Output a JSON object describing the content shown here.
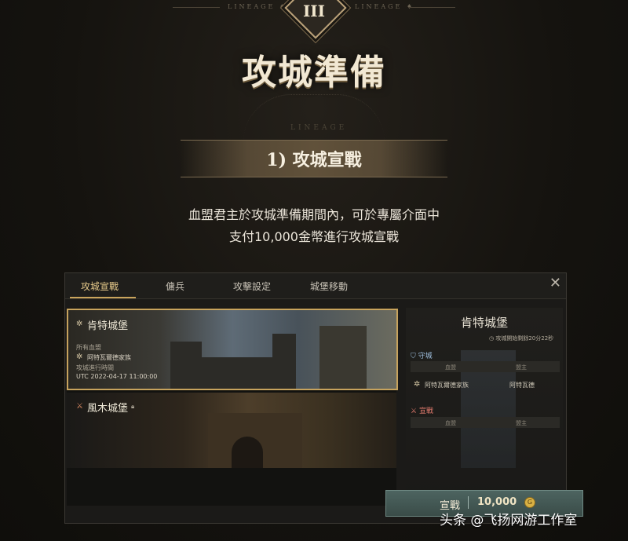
{
  "header": {
    "rune_left": "LINEAGE ♦",
    "rune_right": "LINEAGE ♦",
    "chapter_numeral": "III",
    "title": "攻城準備",
    "arc_text": "LINEAGE"
  },
  "section": {
    "banner": "1) 攻城宣戰",
    "desc_line1": "血盟君主於攻城準備期間內，可於專屬介面中",
    "desc_line2": "支付10,000金幣進行攻城宣戰"
  },
  "panel": {
    "tabs": [
      "攻城宣戰",
      "傭兵",
      "攻擊設定",
      "城堡移動"
    ],
    "active_tab": 0,
    "close_icon": "close-icon",
    "castles": [
      {
        "name": "肯特城堡",
        "owner_label": "所有血盟",
        "owner": "阿特瓦爾德家族",
        "time_label": "攻城進行時間",
        "time": "UTC 2022-04-17 11:00:00",
        "selected": true
      },
      {
        "name": "風木城堡",
        "selected": false
      }
    ],
    "detail": {
      "title": "肯特城堡",
      "timer": "◷ 攻城開始剩餘20分22秒",
      "defense_label": "守城",
      "defense_headers": [
        "血盟",
        "盟主"
      ],
      "defense_row": [
        "阿特瓦爾德家族",
        "阿特瓦德"
      ],
      "attack_label": "宣戰",
      "attack_headers": [
        "血盟",
        "盟主"
      ]
    },
    "declare": {
      "label": "宣戰",
      "cost": "10,000"
    }
  },
  "watermark": "头条 @飞扬网游工作室",
  "colors": {
    "accent_gold": "#c9a45c",
    "defense_blue": "#9fc0df",
    "attack_red": "#e07a6d",
    "declare_teal": "#4d6460"
  }
}
